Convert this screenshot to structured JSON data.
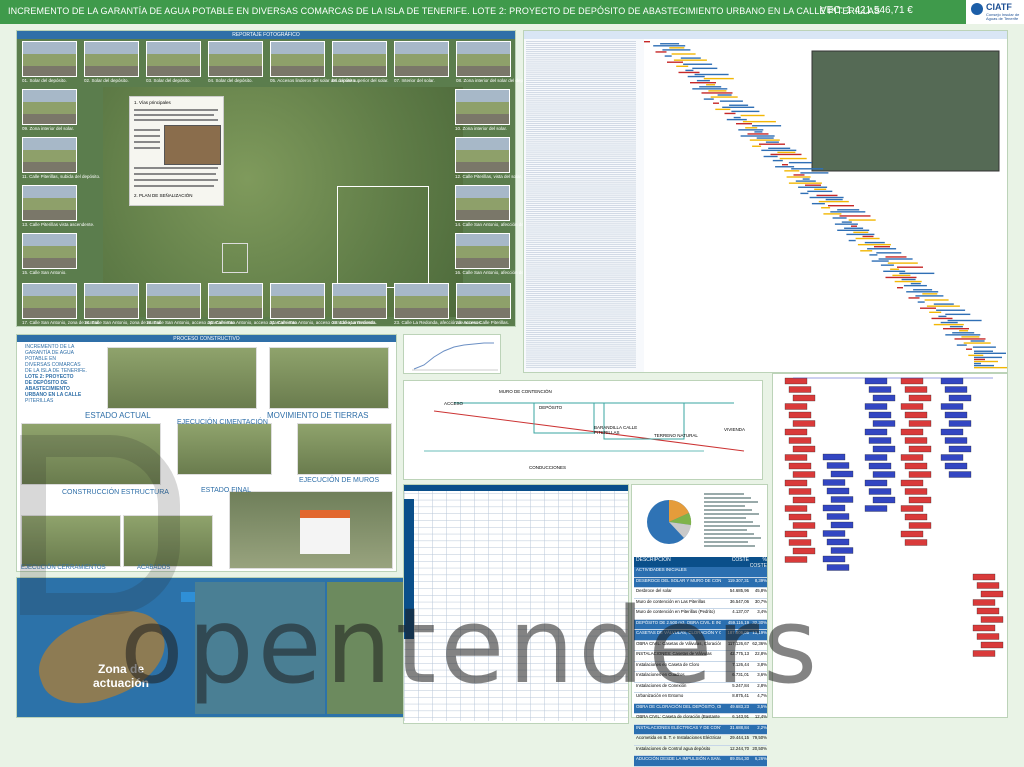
{
  "header": {
    "title": "INCREMENTO DE LA GARANTÍA DE AGUA POTABLE EN DIVERSAS COMARCAS DE LA ISLA DE TENERIFE. LOTE 2: PROYECTO DE DEPÓSITO DE ABASTECIMIENTO URBANO EN LA CALLE PITERILLAS",
    "budget": "VEC: 1.421.546,71 €",
    "logo_name": "CIATF",
    "logo_sub": "Consejo Insular de Aguas de Tenerife"
  },
  "photo_report": {
    "title": "REPORTAJE FOTOGRÁFICO",
    "top_captions": [
      "01. Solar del depósito.",
      "02. Solar del depósito.",
      "03. Solar del depósito.",
      "04. Solar del depósito.",
      "05. Accesos linderos del solar del depósito.",
      "06. Límite superior del solar.",
      "07. Interior del solar.",
      "08. Zona interior del solar del depósito."
    ],
    "left_captions": [
      "09. Zona interior del solar.",
      "11. Calle Piterillas, subida del depósito.",
      "13. Calle Piterillas vista ascendente.",
      "15. Calle San Antonio."
    ],
    "right_captions": [
      "10. Zona interior del solar.",
      "12. Calle Piterillas, vista del solar.",
      "14. Calle San Antonio, afección de acceso.",
      "16. Calle San Antonio, afección de acceso."
    ],
    "bottom_captions": [
      "17. Calle San Antonio, zona de acceso.",
      "18. Calle San Antonio, zona de acceso.",
      "19. Calle San Antonio, acceso aparcamiento.",
      "20. Calle San Antonio, acceso aparcamiento.",
      "21. Calle San Antonio, acceso cerrado aparcamiento.",
      "22. Calle La Redonda.",
      "23. Calle La Redonda, afección de accesos.",
      "24. Acceso Calle Piterillas."
    ],
    "textbox_title": "1. Vías principales",
    "textbox_footer": "2. PLAN DE SEÑALIZACIÓN"
  },
  "process": {
    "title": "PROCESO CONSTRUCTIVO",
    "intro": [
      "INCREMENTO DE LA",
      "GARANTÍA DE AGUA",
      "POTABLE EN",
      "DIVERSAS COMARCAS",
      "DE LA ISLA DE TENERIFE.",
      "LOTE 2: PROYECTO",
      "DE DEPÓSITO DE",
      "ABASTECIMIENTO",
      "URBANO EN LA CALLE",
      "PITERILLAS"
    ],
    "stages": [
      "ESTADO ACTUAL",
      "MOVIMIENTO DE TIERRAS",
      "EJECUCIÓN CIMENTACIÓN",
      "CONSTRUCCIÓN ESTRUCTURA",
      "EJECUCIÓN DE MUROS",
      "ESTADO FINAL",
      "EJECUCIÓN CERRAMIENTOS",
      "ACABADOS"
    ]
  },
  "map": {
    "zone_label_1": "Zona de",
    "zone_label_2": "actuación"
  },
  "section": {
    "labels": [
      "ACCESO",
      "MURO DE CONTENCIÓN",
      "DEPÓSITO",
      "BARANDILLA CALLE PITERILLAS",
      "TERRENO NATURAL",
      "VIVIENDA",
      "CONDUCCIONES"
    ]
  },
  "cost_table": {
    "headers": [
      "DESCRIPCIÓN",
      "COSTE",
      "% COSTE"
    ],
    "rows": [
      {
        "desc": "ACTIVIDADES INICIALES",
        "cost": "",
        "pct": "",
        "hl": true
      },
      {
        "desc": "DESBROCE DEL SOLAR Y MURO DE CONTENCIÓN CALLE LAS PITERILLAS",
        "cost": "119.307,31",
        "pct": "8,39%",
        "hl": true
      },
      {
        "desc": "Desbroce del solar",
        "cost": "54.685,96",
        "pct": "45,8%",
        "hl": false
      },
      {
        "desc": "Muro de contención en Las Piterillas",
        "cost": "36.547,06",
        "pct": "30,7%",
        "hl": false
      },
      {
        "desc": "Muro de contención en Piterillas (Pedrito)",
        "cost": "4.137,07",
        "pct": "3,4%",
        "hl": false
      },
      {
        "desc": "DEPÓSITO DE 2.500 m3, OBRA CIVIL E INSTALACIONES",
        "cost": "459.116,19",
        "pct": "32,30%",
        "hl": true
      },
      {
        "desc": "CASETAS DE VÁLVULAS, CLORACIÓN Y CUADROS BAJA TENSIÓN",
        "cost": "187.806,05",
        "pct": "13,19%",
        "hl": true
      },
      {
        "desc": "OBRA CIVIL: Casetas de Válvulas, Cloración",
        "cost": "117.126,67",
        "pct": "62,36%",
        "hl": false
      },
      {
        "desc": "INSTALACIONES: Casetas de Válvulas",
        "cost": "42.775,13",
        "pct": "22,8%",
        "hl": false
      },
      {
        "desc": "Instalaciones en Caseta de Cloro",
        "cost": "7.126,44",
        "pct": "3,8%",
        "hl": false
      },
      {
        "desc": "Instalaciones en Cuadros",
        "cost": "6.731,01",
        "pct": "3,6%",
        "hl": false
      },
      {
        "desc": "Instalaciones de Conexión",
        "cost": "5.247,84",
        "pct": "2,8%",
        "hl": false
      },
      {
        "desc": "Urbanización en Entorno",
        "cost": "8.875,41",
        "pct": "4,7%",
        "hl": false
      },
      {
        "desc": "OBRA DE CLORACIÓN DEL DEPÓSITO, OBRA CIVIL E INSTALACIONES",
        "cost": "49.683,23",
        "pct": "3,5%",
        "hl": true
      },
      {
        "desc": "OBRA CIVIL: Caseta de cloración (Bastante Elevada, Bloque)",
        "cost": "6.143,91",
        "pct": "12,4%",
        "hl": false
      },
      {
        "desc": "INSTALACIONES ELÉCTRICAS Y DE CONTROL",
        "cost": "31.688,84",
        "pct": "2,2%",
        "hl": true
      },
      {
        "desc": "Acometida en B. T. e Instalaciones Eléctricas y Telecontrol",
        "cost": "29.444,15",
        "pct": "79,50%",
        "hl": false
      },
      {
        "desc": "Instalaciones de Control agua depósito",
        "cost": "12.244,70",
        "pct": "20,50%",
        "hl": false
      },
      {
        "desc": "ADUCCIÓN DESDE LA IMPULSIÓN A SAN ANTONIO AL DEPÓSITO DE ABASTECIMIENTO",
        "cost": "89.054,30",
        "pct": "6,26%",
        "hl": true
      }
    ]
  },
  "watermark": "opentenders"
}
